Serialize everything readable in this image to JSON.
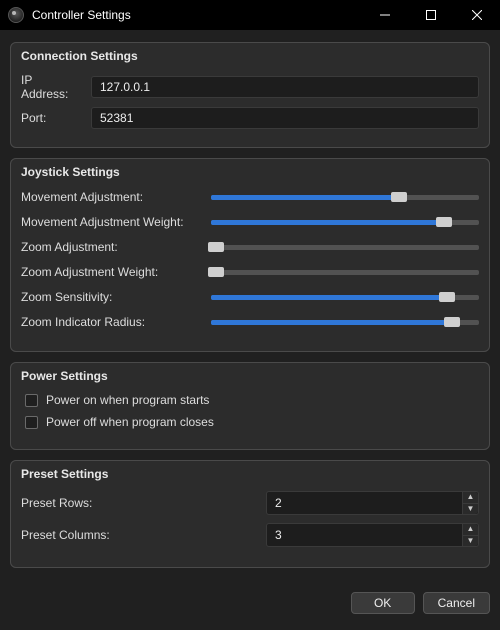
{
  "window": {
    "title": "Controller Settings"
  },
  "connection": {
    "group_title": "Connection Settings",
    "ip_label": "IP Address:",
    "ip_value": "127.0.0.1",
    "port_label": "Port:",
    "port_value": "52381"
  },
  "joystick": {
    "group_title": "Joystick Settings",
    "rows": [
      {
        "label": "Movement Adjustment:",
        "pct": 70
      },
      {
        "label": "Movement Adjustment Weight:",
        "pct": 87
      },
      {
        "label": "Zoom Adjustment:",
        "pct": 2
      },
      {
        "label": "Zoom Adjustment Weight:",
        "pct": 2
      },
      {
        "label": "Zoom Sensitivity:",
        "pct": 88
      },
      {
        "label": "Zoom Indicator Radius:",
        "pct": 90
      }
    ]
  },
  "power": {
    "group_title": "Power Settings",
    "items": [
      {
        "label": "Power on when program starts",
        "checked": false
      },
      {
        "label": "Power off when program closes",
        "checked": false
      }
    ]
  },
  "preset": {
    "group_title": "Preset Settings",
    "rows_label": "Preset Rows:",
    "rows_value": "2",
    "cols_label": "Preset Columns:",
    "cols_value": "3"
  },
  "buttons": {
    "ok": "OK",
    "cancel": "Cancel"
  }
}
